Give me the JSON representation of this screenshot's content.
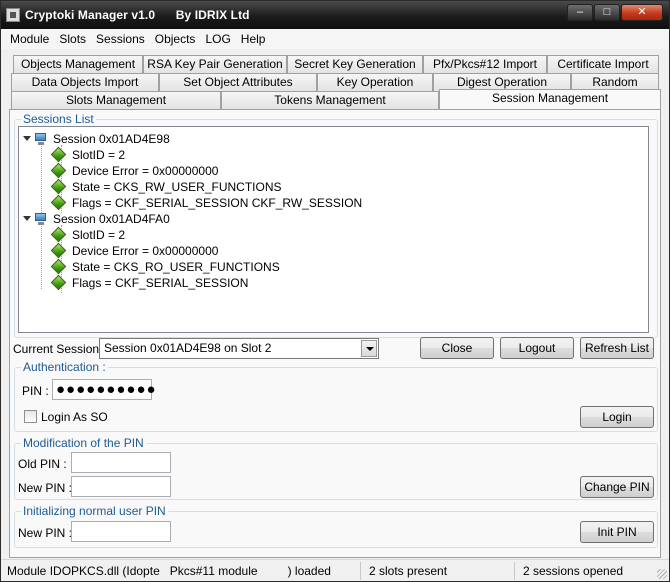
{
  "window": {
    "title": "Cryptoki Manager v1.0      By IDRIX Ltd",
    "minimize_glyph": "‒",
    "maximize_glyph": "□",
    "close_glyph": "✕"
  },
  "menu": [
    "Module",
    "Slots",
    "Sessions",
    "Objects",
    "LOG",
    "Help"
  ],
  "tabs": {
    "row1": [
      "Objects Management",
      "RSA Key Pair Generation",
      "Secret Key Generation",
      "Pfx/Pkcs#12 Import",
      "Certificate Import"
    ],
    "row2": [
      "Data Objects Import",
      "Set Object Attributes",
      "Key Operation",
      "Digest Operation",
      "Random"
    ],
    "row3": [
      "Slots Management",
      "Tokens Management",
      "Session Management"
    ],
    "active": "Session Management"
  },
  "sessions_list": {
    "legend": "Sessions List",
    "sessions": [
      {
        "name": "Session 0x01AD4E98",
        "properties": [
          "SlotID = 2",
          "Device Error = 0x00000000",
          "State = CKS_RW_USER_FUNCTIONS",
          "Flags = CKF_SERIAL_SESSION CKF_RW_SESSION"
        ]
      },
      {
        "name": "Session 0x01AD4FA0",
        "properties": [
          "SlotID = 2",
          "Device Error = 0x00000000",
          "State = CKS_RO_USER_FUNCTIONS",
          "Flags = CKF_SERIAL_SESSION"
        ]
      }
    ]
  },
  "current_session": {
    "label": "Current Session :",
    "value": "Session 0x01AD4E98 on Slot 2"
  },
  "buttons": {
    "close": "Close",
    "logout": "Logout",
    "refresh": "Refresh List",
    "login": "Login",
    "change_pin": "Change PIN",
    "init_pin": "Init PIN"
  },
  "authentication": {
    "legend": "Authentication :",
    "pin_label": "PIN :",
    "pin_value": "●●●●●●●●●●",
    "login_as_so_label": "Login As SO"
  },
  "modification": {
    "legend": "Modification of the PIN",
    "old_pin_label": "Old PIN :",
    "new_pin_label": "New PIN :"
  },
  "init_user": {
    "legend": "Initializing normal user PIN",
    "new_pin_label": "New PIN :"
  },
  "status": {
    "module": "Module IDOPKCS.dll (Idopte   Pkcs#11 module         ) loaded",
    "slots": "2 slots present",
    "sessions": "2 sessions opened"
  }
}
